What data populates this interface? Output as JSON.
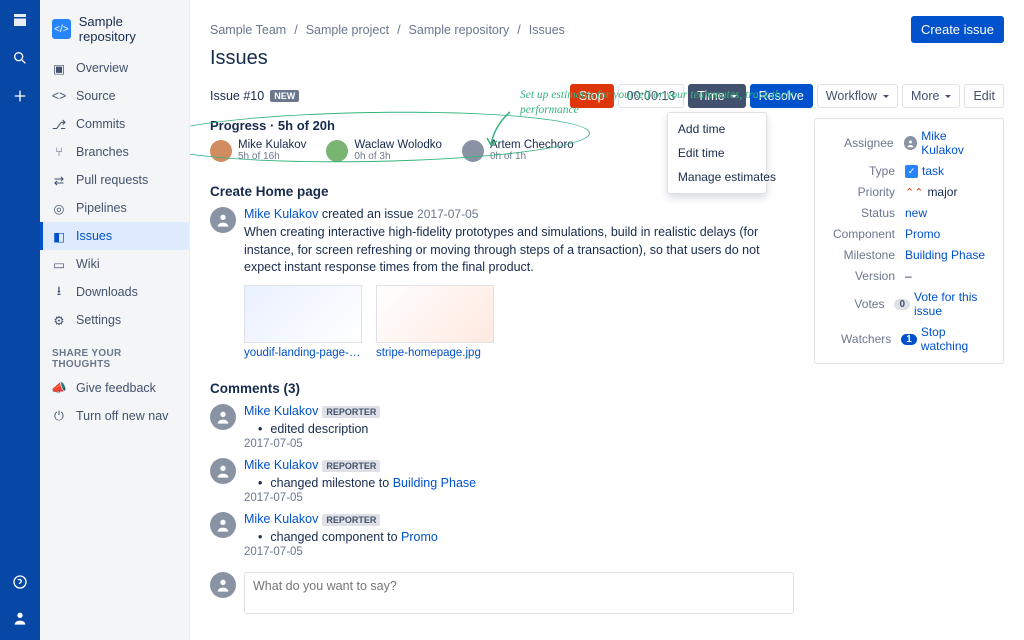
{
  "repo_name": "Sample repository",
  "sidebar": {
    "items": [
      "Overview",
      "Source",
      "Commits",
      "Branches",
      "Pull requests",
      "Pipelines",
      "Issues",
      "Wiki",
      "Downloads",
      "Settings"
    ],
    "share_label": "SHARE YOUR THOUGHTS",
    "feedback": "Give feedback",
    "turnoff": "Turn off new nav"
  },
  "breadcrumb": [
    "Sample Team",
    "Sample project",
    "Sample repository",
    "Issues"
  ],
  "page_title": "Issues",
  "create_label": "Create issue",
  "issue_num": "Issue #10",
  "new_badge": "NEW",
  "toolbar": {
    "stop": "Stop",
    "timer": "00:00:13",
    "time": "Time",
    "resolve": "Resolve",
    "workflow": "Workflow",
    "more": "More",
    "edit": "Edit"
  },
  "time_menu": [
    "Add time",
    "Edit time",
    "Manage estimates"
  ],
  "annotation": "Set up estimates for yourself or your teammates, track their performance",
  "progress": {
    "title": "Progress · 5h of 20h",
    "people": [
      {
        "name": "Mike Kulakov",
        "sub": "5h of 16h"
      },
      {
        "name": "Waclaw Wolodko",
        "sub": "0h of 3h"
      },
      {
        "name": "Artem Chechoro",
        "sub": "0h of 1h"
      }
    ]
  },
  "create_section": "Create Home page",
  "activity": {
    "author": "Mike Kulakov",
    "action": "created an issue",
    "date": "2017-07-05",
    "desc": "When creating interactive high-fidelity prototypes and simulations, build in realistic delays (for instance, for screen refreshing or moving through steps of a transaction), so that users do not expect instant response times from the final product."
  },
  "attachments": [
    "youdif-landing-page-ale...",
    "stripe-homepage.jpg"
  ],
  "comments_title": "Comments (3)",
  "reporter_badge": "REPORTER",
  "comments": [
    {
      "author": "Mike Kulakov",
      "text": "edited description",
      "date": "2017-07-05"
    },
    {
      "author": "Mike Kulakov",
      "text": "changed milestone to ",
      "link": "Building Phase",
      "date": "2017-07-05"
    },
    {
      "author": "Mike Kulakov",
      "text": "changed component to ",
      "link": "Promo",
      "date": "2017-07-05"
    }
  ],
  "comment_placeholder": "What do you want to say?",
  "meta": {
    "assignee_l": "Assignee",
    "assignee": "Mike Kulakov",
    "type_l": "Type",
    "type": "task",
    "priority_l": "Priority",
    "priority": "major",
    "status_l": "Status",
    "status": "new",
    "component_l": "Component",
    "component": "Promo",
    "milestone_l": "Milestone",
    "milestone": "Building Phase",
    "version_l": "Version",
    "version": "–",
    "votes_l": "Votes",
    "votes_count": "0",
    "votes": "Vote for this issue",
    "watchers_l": "Watchers",
    "watchers_count": "1",
    "watchers": "Stop watching"
  }
}
